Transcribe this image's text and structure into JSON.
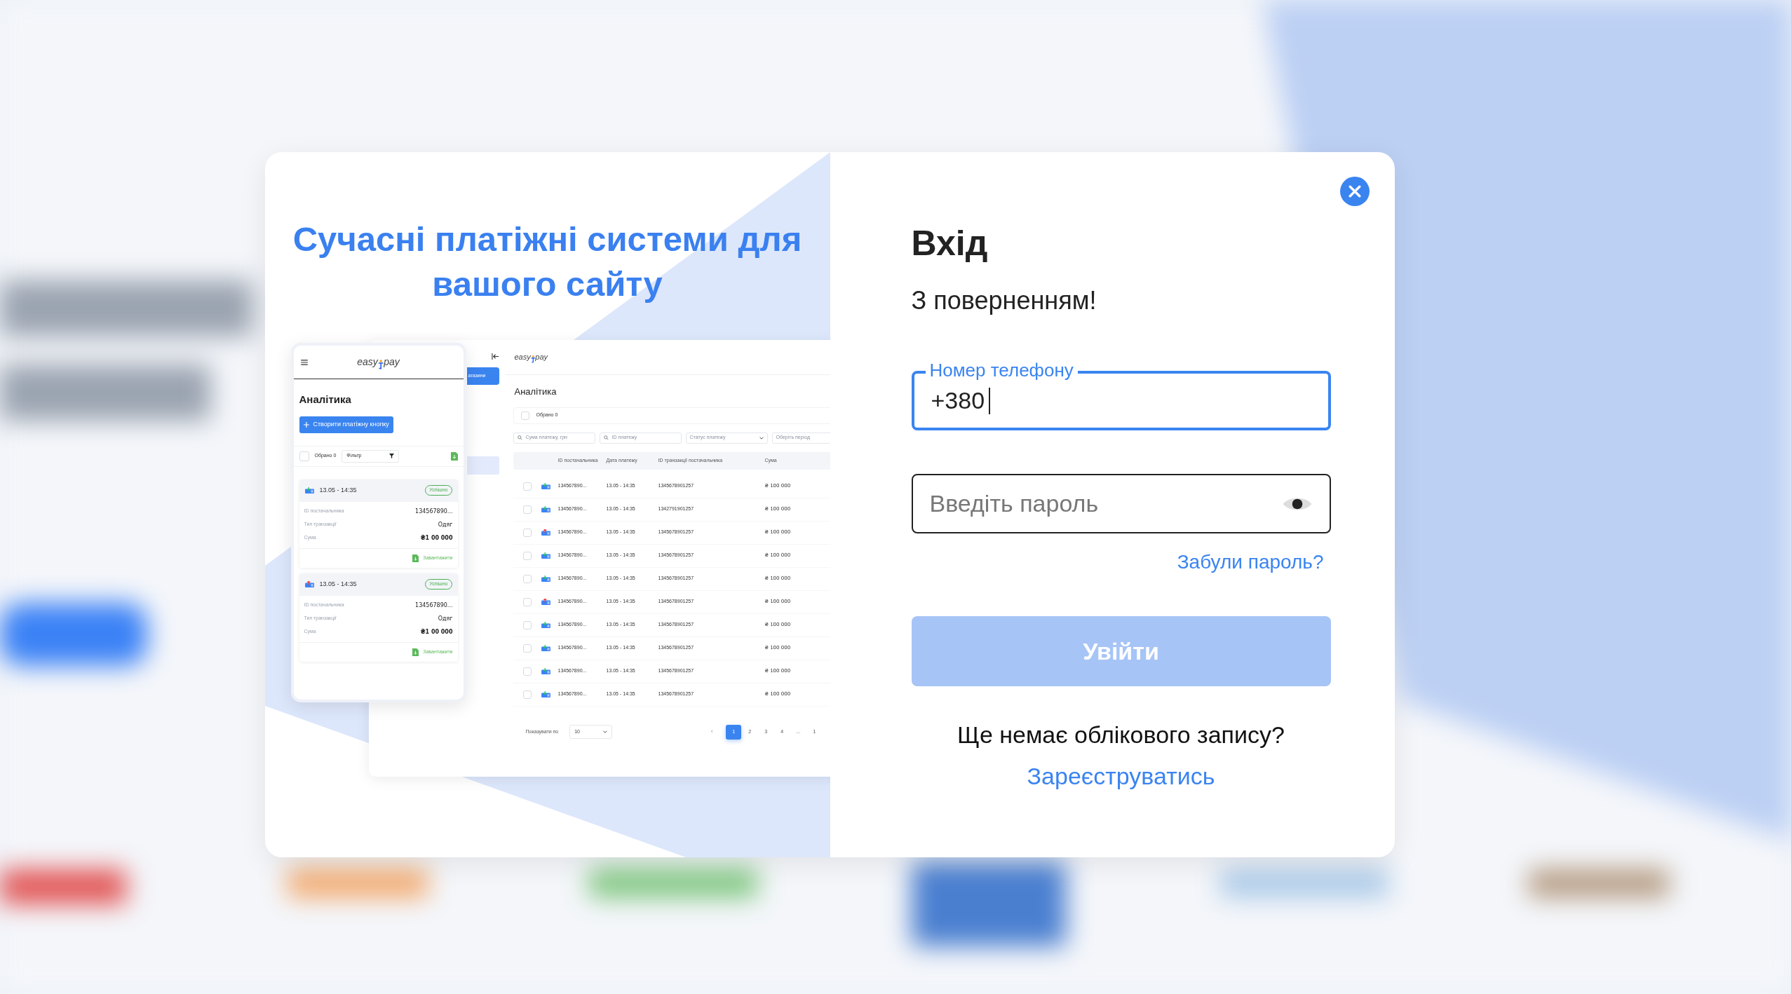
{
  "promo": {
    "title": "Сучасні платіжні системи для вашого сайту",
    "desktop": {
      "logo": [
        "easy",
        "pay"
      ],
      "sidebar_button": "агазини",
      "heading": "Аналітика",
      "selected_count": "Обрано 0",
      "all_checked": false,
      "filters": [
        {
          "placeholder": "Сума платежу, грн",
          "kind": "search"
        },
        {
          "placeholder": "ID платежу",
          "kind": "search"
        },
        {
          "placeholder": "Статус платежу",
          "kind": "select"
        },
        {
          "placeholder": "Оберіть період",
          "kind": "plain"
        }
      ],
      "columns": [
        "ID постачальника",
        "Дата платежу",
        "ID транзакції постачальника",
        "Сума"
      ],
      "rows": [
        {
          "kind": "incoming",
          "checked": false,
          "supplier_id": "134567890...",
          "date": "13.05 - 14:35",
          "transaction_id": "1345678901257",
          "sum": "₴ 100 000"
        },
        {
          "kind": "incoming",
          "checked": false,
          "supplier_id": "134567890...",
          "date": "13.05 - 14:35",
          "transaction_id": "1342791901257",
          "sum": "₴ 100 000"
        },
        {
          "kind": "outgoing",
          "checked": false,
          "supplier_id": "134567890...",
          "date": "13.05 - 14:35",
          "transaction_id": "1345678901257",
          "sum": "₴ 100 000"
        },
        {
          "kind": "incoming",
          "checked": false,
          "supplier_id": "134567890...",
          "date": "13.05 - 14:35",
          "transaction_id": "1345678901257",
          "sum": "₴ 100 000"
        },
        {
          "kind": "incoming",
          "checked": false,
          "supplier_id": "134567890...",
          "date": "13.05 - 14:35",
          "transaction_id": "1345678901257",
          "sum": "₴ 100 000"
        },
        {
          "kind": "outgoing",
          "checked": false,
          "supplier_id": "134567890...",
          "date": "13.05 - 14:35",
          "transaction_id": "1345678901257",
          "sum": "₴ 100 000"
        },
        {
          "kind": "incoming",
          "checked": false,
          "supplier_id": "134567890...",
          "date": "13.05 - 14:35",
          "transaction_id": "1345678901257",
          "sum": "₴ 100 000"
        },
        {
          "kind": "incoming",
          "checked": false,
          "supplier_id": "134567890...",
          "date": "13.05 - 14:35",
          "transaction_id": "1345678901257",
          "sum": "₴ 100 000"
        },
        {
          "kind": "incoming",
          "checked": false,
          "supplier_id": "134567890...",
          "date": "13.05 - 14:35",
          "transaction_id": "1345678901257",
          "sum": "₴ 100 000"
        },
        {
          "kind": "incoming",
          "checked": false,
          "supplier_id": "134567890...",
          "date": "13.05 - 14:35",
          "transaction_id": "1345678901257",
          "sum": "₴ 100 000"
        }
      ],
      "page_size_label": "Показувати по",
      "page_size": "10",
      "prev": "‹",
      "pages": [
        {
          "label": "1",
          "selected": true
        },
        {
          "label": "2",
          "selected": false
        },
        {
          "label": "3",
          "selected": false
        },
        {
          "label": "4",
          "selected": false
        },
        {
          "label": "...",
          "selected": false
        },
        {
          "label": "1",
          "selected": false
        }
      ]
    },
    "mobile": {
      "logo": [
        "easy",
        "pay"
      ],
      "heading": "Аналітика",
      "create_button": "Створити платіжну кнопку",
      "selected_count": "Обрано 0",
      "all_checked": false,
      "filter": "Фільтр",
      "cards": [
        {
          "kind": "incoming",
          "date": "13.05 - 14:35",
          "status": "Успішно",
          "fields": [
            {
              "label": "ID постачальника",
              "value": "134567890..."
            },
            {
              "label": "Тип транзакції",
              "value": "Одяг"
            },
            {
              "label": "Сума",
              "value": "₴1 00 000"
            }
          ],
          "download": "Завантажити"
        },
        {
          "kind": "outgoing",
          "date": "13.05 - 14:35",
          "status": "Успішно",
          "fields": [
            {
              "label": "ID постачальника",
              "value": "134567890..."
            },
            {
              "label": "Тип транзакції",
              "value": "Одяг"
            },
            {
              "label": "Сума",
              "value": "₴1 00 000"
            }
          ],
          "download": "Завантажити"
        }
      ]
    }
  },
  "login": {
    "title": "Вхід",
    "subtitle": "З поверненням!",
    "phone": {
      "label": "Номер телефону",
      "value": "+380",
      "focused": true
    },
    "password": {
      "placeholder": "Введіть пароль",
      "focused": false
    },
    "forgot_link": "Забули пароль?",
    "submit": {
      "label": "Увійти",
      "disabled": true
    },
    "no_account": "Ще немає облікового запису?",
    "register_link": "Зареєструватись"
  }
}
